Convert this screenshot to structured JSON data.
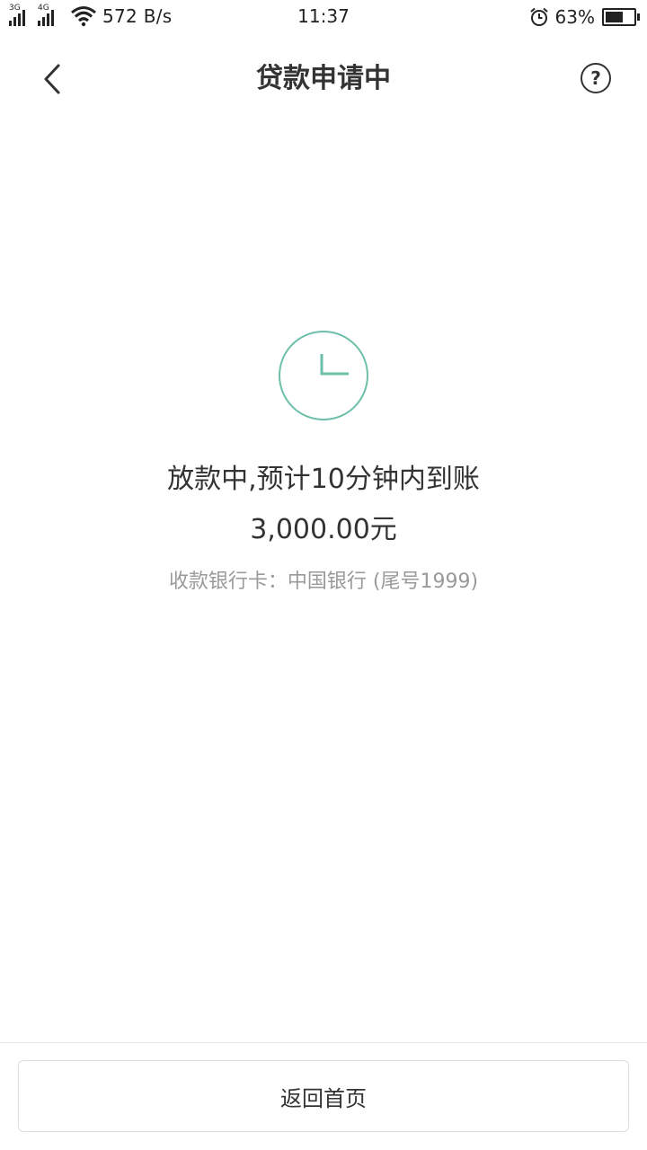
{
  "status_bar": {
    "signal1_label": "3G",
    "signal2_label": "4G",
    "net_speed": "572 B/s",
    "time": "11:37",
    "battery_percent": "63%",
    "battery_level": 0.63,
    "icons": [
      "signal-icon",
      "wifi-icon",
      "alarm-icon",
      "battery-icon"
    ]
  },
  "nav": {
    "title": "贷款申请中",
    "back_icon": "chevron-left-icon",
    "help_symbol": "?"
  },
  "main": {
    "status_icon": "clock-icon",
    "accent_color": "#6cbfa9",
    "headline": "放款中,预计10分钟内到账",
    "amount": "3,000.00元",
    "bank_info": "收款银行卡：中国银行 (尾号1999)"
  },
  "footer": {
    "home_button_label": "返回首页"
  }
}
